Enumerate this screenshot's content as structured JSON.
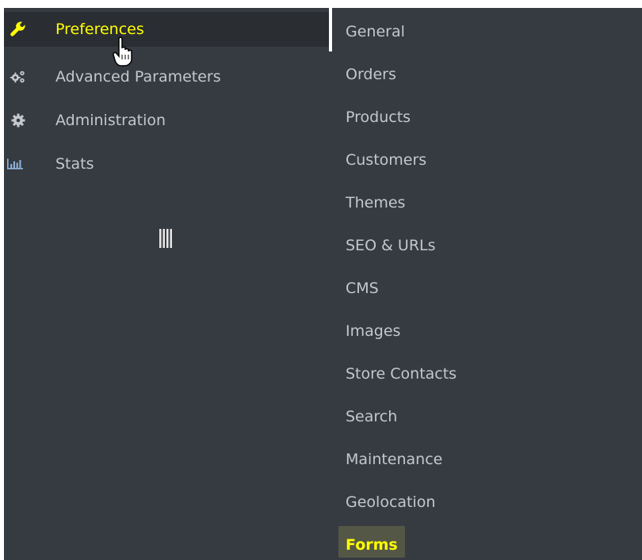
{
  "main_menu": {
    "items": [
      {
        "label": "Preferences",
        "icon": "wrench-icon",
        "active": true
      },
      {
        "label": "Advanced Parameters",
        "icon": "gears-icon",
        "active": false
      },
      {
        "label": "Administration",
        "icon": "gear-icon",
        "active": false
      },
      {
        "label": "Stats",
        "icon": "bar-chart-icon",
        "active": false
      }
    ]
  },
  "submenu": {
    "items": [
      "General",
      "Orders",
      "Products",
      "Customers",
      "Themes",
      "SEO & URLs",
      "CMS",
      "Images",
      "Store Contacts",
      "Search",
      "Maintenance",
      "Geolocation",
      "Forms"
    ],
    "active": "Forms"
  },
  "colors": {
    "background": "#363a41",
    "text": "#c4c8cd",
    "active_text": "#ffff00",
    "icon_active": "#ffff00",
    "icon_inactive": "#c4c8cd"
  }
}
